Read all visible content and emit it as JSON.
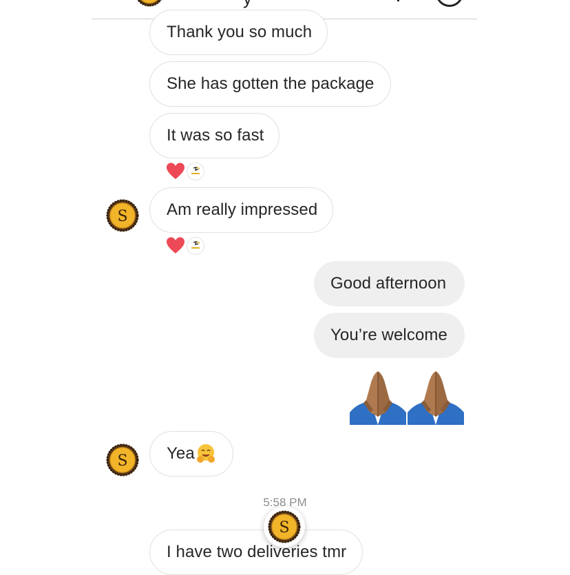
{
  "header": {
    "contact_avatar": "coin-s-avatar",
    "icons": [
      "info-icon"
    ]
  },
  "messages": [
    {
      "direction": "incoming",
      "text": "Thank you so much"
    },
    {
      "direction": "incoming",
      "text": "She has gotten the package"
    },
    {
      "direction": "incoming",
      "text": "It was so fast",
      "reactions": [
        "heart-icon",
        "sender-badge-icon"
      ]
    },
    {
      "direction": "incoming",
      "text": "Am really impressed",
      "reactions": [
        "heart-icon",
        "sender-badge-icon"
      ]
    },
    {
      "direction": "outgoing",
      "text": "Good afternoon"
    },
    {
      "direction": "outgoing",
      "text": "You’re welcome"
    },
    {
      "direction": "outgoing",
      "emoji": "folded-hands-icon"
    },
    {
      "direction": "incoming",
      "text": "Yea",
      "emoji": "hugging-face-icon"
    },
    {
      "direction": "incoming",
      "text": "I have two deliveries tmr"
    }
  ],
  "timestamp": "5:58 PM",
  "avatar_letter": "S",
  "colors": {
    "incoming_border": "#e0e0e0",
    "outgoing_bg": "#efefef",
    "text": "#262626",
    "timestamp": "#8e8e8e",
    "heart": "#ed4956",
    "coin_gold": "#f2b52a"
  }
}
